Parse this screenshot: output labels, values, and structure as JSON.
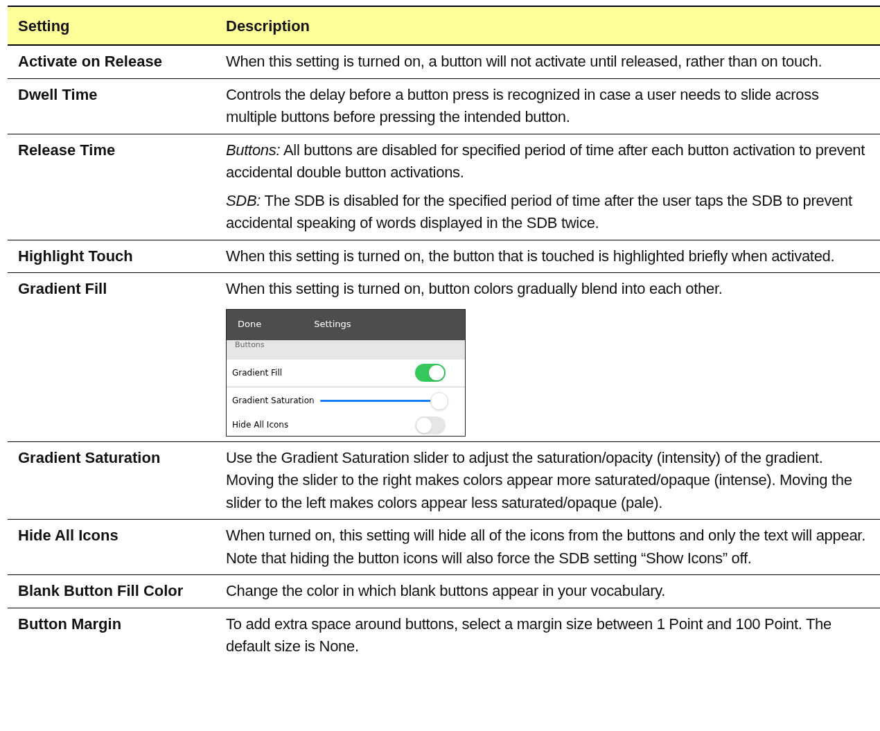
{
  "table": {
    "columns": [
      "Setting",
      "Description"
    ],
    "rows": [
      {
        "setting": "Activate on Release",
        "paragraphs": [
          "When this setting is turned on, a button will not activate until released, rather than on touch."
        ]
      },
      {
        "setting": "Dwell Time",
        "paragraphs": [
          "Controls the delay before a button press is recognized in case a user needs to slide across multiple buttons before pressing the intended button."
        ]
      },
      {
        "setting": "Release Time",
        "paragraphs": [
          "*Buttons:* All buttons are disabled for specified period of time after each button activation to prevent accidental double button activations.",
          "*SDB:* The SDB is disabled for the specified period of time after the user taps the SDB to prevent accidental speaking of words displayed in the SDB twice."
        ]
      },
      {
        "setting": "Highlight Touch",
        "paragraphs": [
          "When this setting is turned on, the button that is touched is highlighted briefly when activated."
        ]
      },
      {
        "setting": "Gradient Fill",
        "paragraphs": [
          "When this setting is turned on, button colors gradually blend into each other."
        ],
        "screenshot": {
          "nav_button": "Done",
          "nav_title": "Settings",
          "section": "Buttons",
          "items": [
            {
              "kind": "toggle",
              "label": "Gradient Fill",
              "on": true
            },
            {
              "kind": "slider",
              "label": "Gradient Saturation",
              "level": 1
            },
            {
              "kind": "toggle",
              "label": "Hide All Icons",
              "on": false
            }
          ]
        }
      },
      {
        "setting": "Gradient Saturation",
        "paragraphs": [
          "Use the Gradient Saturation slider to adjust the saturation/opacity (intensity) of the gradient. Moving the slider to the right makes colors appear more saturated/opaque (intense). Moving the slider to the left makes colors appear less saturated/opaque (pale)."
        ]
      },
      {
        "setting": "Hide All Icons",
        "paragraphs": [
          "When turned on, this setting will hide all of the icons from the buttons and only the text will appear. Note that hiding the button icons will also force the SDB setting “Show Icons” off."
        ]
      },
      {
        "setting": "Blank Button Fill Color",
        "paragraphs": [
          "Change the color in which blank buttons appear in your vocabulary."
        ]
      },
      {
        "setting": "Button Margin",
        "paragraphs": [
          "To add extra space around buttons, select a margin size between 1 Point and 100 Point. The default size is None."
        ]
      }
    ]
  }
}
